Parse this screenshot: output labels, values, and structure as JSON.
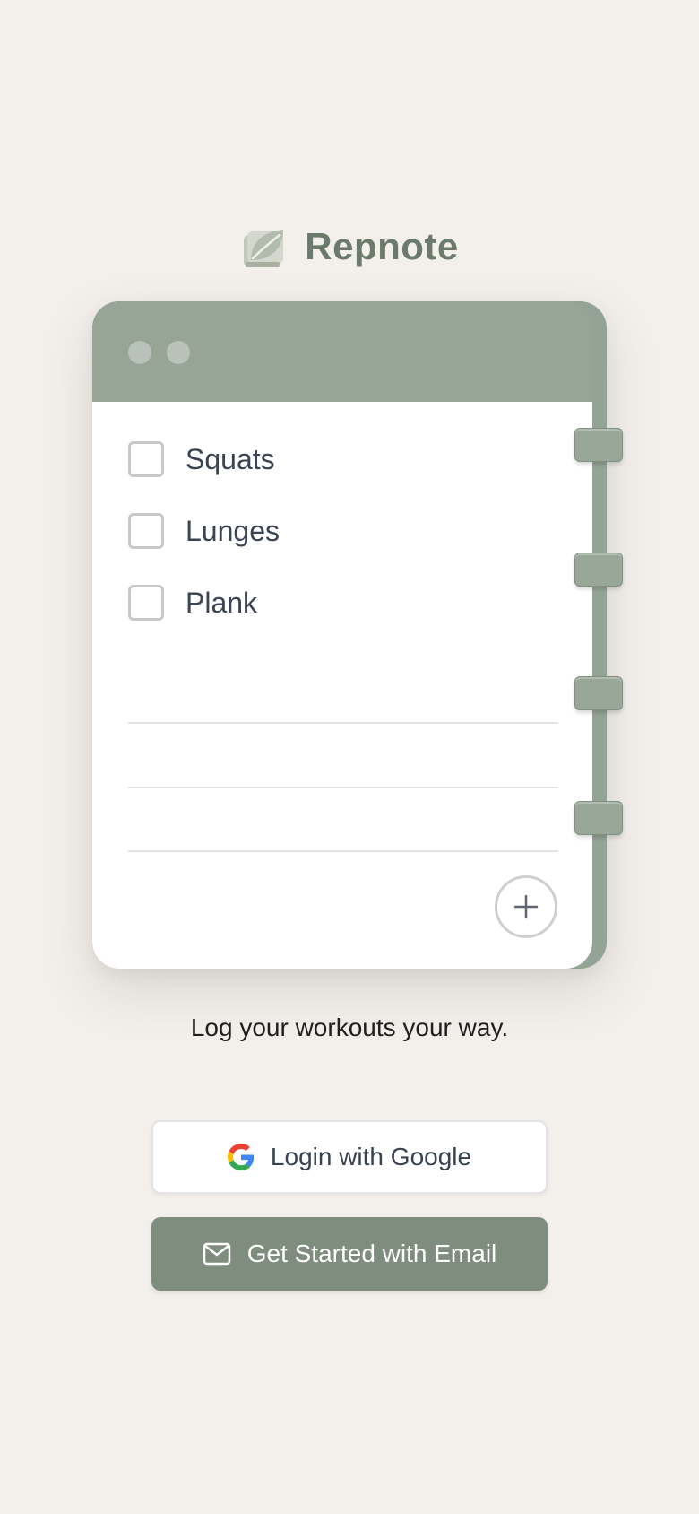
{
  "brand": {
    "name": "Repnote",
    "logo_icon": "leaf-book-icon"
  },
  "notebook": {
    "window_dots": [
      "window-dot",
      "window-dot"
    ],
    "items": [
      {
        "label": "Squats",
        "checked": false
      },
      {
        "label": "Lunges",
        "checked": false
      },
      {
        "label": "Plank",
        "checked": false
      }
    ],
    "add_icon": "plus-icon",
    "ring_count": 4
  },
  "tagline": "Log your workouts your way.",
  "buttons": {
    "google": {
      "label": "Login with Google",
      "icon": "google-icon"
    },
    "email": {
      "label": "Get Started with Email",
      "icon": "mail-icon"
    }
  },
  "colors": {
    "background": "#f3f0ec",
    "accent": "#7e8d7e",
    "brand_text": "#6b7a6a",
    "notebook_frame": "#93a395"
  }
}
